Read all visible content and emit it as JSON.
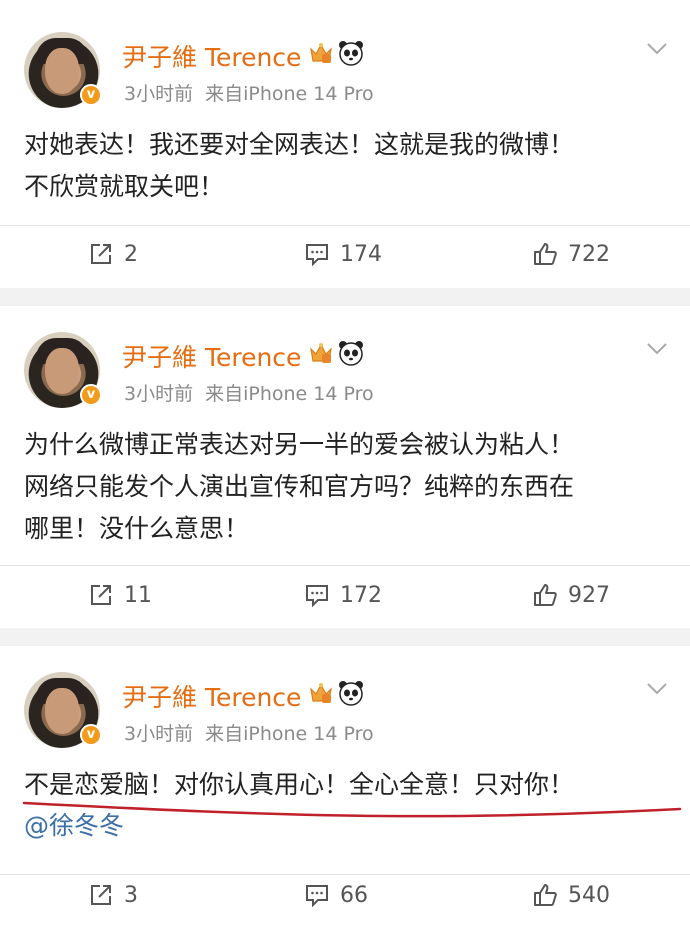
{
  "posts": [
    {
      "name": "尹子維 Terence",
      "verified_badge": "v",
      "time": "3小时前",
      "source": "来自iPhone 14 Pro",
      "text_lines": [
        "对她表达！我还要对全网表达！这就是我的微博！",
        "不欣赏就取关吧！"
      ],
      "reposts": "2",
      "comments": "174",
      "likes": "722"
    },
    {
      "name": "尹子維 Terence",
      "verified_badge": "v",
      "time": "3小时前",
      "source": "来自iPhone 14 Pro",
      "text_lines": [
        "为什么微博正常表达对另一半的爱会被认为粘人！",
        "网络只能发个人演出宣传和官方吗？纯粹的东西在",
        "哪里！没什么意思！"
      ],
      "reposts": "11",
      "comments": "172",
      "likes": "927"
    },
    {
      "name": "尹子維 Terence",
      "verified_badge": "v",
      "time": "3小时前",
      "source": "来自iPhone 14 Pro",
      "text_lines": [
        "不是恋爱脑！对你认真用心！全心全意！只对你！"
      ],
      "mention": "@徐冬冬",
      "reposts": "3",
      "comments": "66",
      "likes": "540"
    }
  ],
  "icons": {
    "repost": "repost-icon",
    "comment": "comment-icon",
    "like": "like-icon",
    "crown": "crown-badge-icon",
    "panda": "panda-icon",
    "more": "chevron-down-icon"
  },
  "colors": {
    "name": "#e66d12",
    "mention": "#3b6fa6",
    "underline": "#c0202a",
    "verified": "#f29a1a"
  }
}
